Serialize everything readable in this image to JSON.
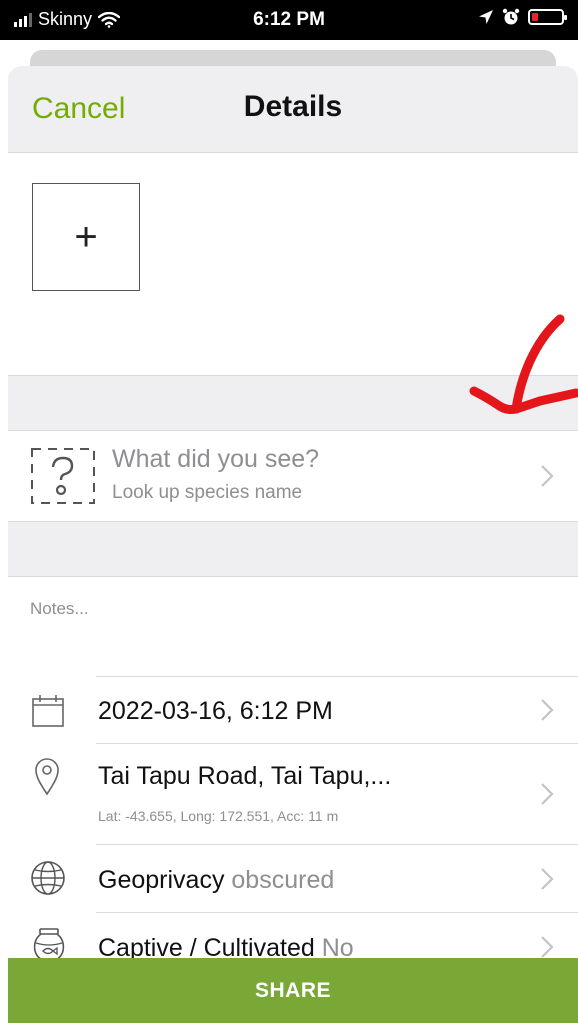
{
  "status_bar": {
    "carrier": "Skinny",
    "time": "6:12 PM",
    "battery_color": "#e5262a"
  },
  "header": {
    "cancel_label": "Cancel",
    "title": "Details",
    "accent_color": "#74ac00"
  },
  "photo": {
    "add_symbol": "+"
  },
  "species": {
    "prompt": "What did you see?",
    "subtitle": "Look up species name",
    "icon": "species-placeholder-icon"
  },
  "notes": {
    "placeholder": "Notes..."
  },
  "details": {
    "date": {
      "label": "2022-03-16, 6:12 PM",
      "icon": "calendar-icon"
    },
    "location": {
      "label": "Tai Tapu Road, Tai Tapu,...",
      "coords": "Lat: -43.655, Long: 172.551, Acc: 11 m",
      "icon": "location-pin-icon"
    },
    "geoprivacy": {
      "label": "Geoprivacy",
      "value": "obscured",
      "icon": "globe-icon"
    },
    "captive": {
      "label": "Captive / Cultivated",
      "value": "No",
      "icon": "fishbowl-icon"
    }
  },
  "share_button": {
    "label": "SHARE",
    "color": "#7aa837"
  }
}
